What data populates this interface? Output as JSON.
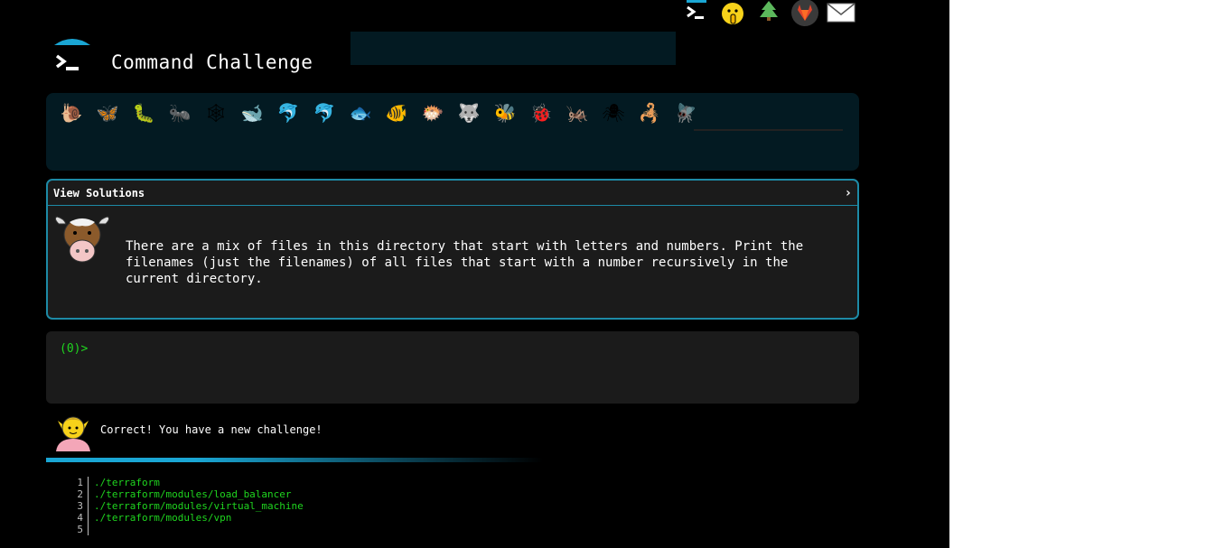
{
  "header": {
    "title": "Command Challenge",
    "icons": [
      "terminal-icon",
      "shush-face-icon",
      "tree-icon",
      "gitlab-icon",
      "mail-icon"
    ]
  },
  "critters": [
    "🐌",
    "🦋",
    "🐛",
    "🐜",
    "🕸",
    "🐋",
    "🐬",
    "🐬",
    "🐟",
    "🐠",
    "🐡",
    "🐺",
    "🐝",
    "🐞",
    "🦗",
    "🕷",
    "🦂",
    "🪰"
  ],
  "challenge": {
    "view_solutions": "View Solutions",
    "chevron": "›",
    "description": "There are a mix of files in this directory that start with letters and numbers. Print the filenames (just the filenames) of all files that start with a number recursively in the current directory."
  },
  "terminal": {
    "prompt": "(0)>"
  },
  "feedback": {
    "message": "Correct! You have a new challenge!"
  },
  "output": {
    "lines": [
      {
        "num": "1",
        "text": "./terraform"
      },
      {
        "num": "2",
        "text": "./terraform/modules/load_balancer"
      },
      {
        "num": "3",
        "text": "./terraform/modules/virtual_machine"
      },
      {
        "num": "4",
        "text": "./terraform/modules/vpn"
      },
      {
        "num": "5",
        "text": ""
      }
    ]
  },
  "colors": {
    "accent": "#1aa6d4",
    "prompt_green": "#1fd61f",
    "panel_dark": "#031a22",
    "panel_gray": "#1b1b1b"
  }
}
